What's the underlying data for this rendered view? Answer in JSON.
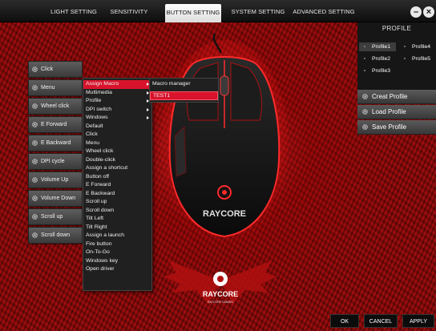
{
  "tabs": [
    {
      "label": "LIGHT SETTING",
      "active": false
    },
    {
      "label": "SENSITIVITY",
      "active": false
    },
    {
      "label": "BUTTON SETTING",
      "active": true
    },
    {
      "label": "SYSTEM SETTING",
      "active": false
    },
    {
      "label": "ADVANCED SETTING",
      "active": false
    }
  ],
  "window": {
    "minimize": "–",
    "close": "×"
  },
  "button_assignments": [
    "Click",
    "Menu",
    "Wheel click",
    "E Forward",
    "E Backward",
    "DPI cycle",
    "Volume Up",
    "Volume Down",
    "Scroll up",
    "Scroll down"
  ],
  "dropdown_menu": [
    {
      "label": "Assign Macro",
      "submenu": true,
      "selected": true
    },
    {
      "label": "Multimedia",
      "submenu": true
    },
    {
      "label": "Profile",
      "submenu": true
    },
    {
      "label": "DPI switch",
      "submenu": true
    },
    {
      "label": "Windows",
      "submenu": true
    },
    {
      "label": "Default"
    },
    {
      "label": "Click"
    },
    {
      "label": "Menu"
    },
    {
      "label": "Wheel click"
    },
    {
      "label": "Double-click"
    },
    {
      "label": "Assign a shortcut"
    },
    {
      "label": "Button off"
    },
    {
      "label": "E Forward"
    },
    {
      "label": "E Backward"
    },
    {
      "label": "Scroll up"
    },
    {
      "label": "Scroll down"
    },
    {
      "label": "Tilt Left"
    },
    {
      "label": "Tilt Right"
    },
    {
      "label": "Assign a launch"
    },
    {
      "label": "Fire button"
    },
    {
      "label": "On-To-Go"
    },
    {
      "label": "Windows key"
    },
    {
      "label": "Open driver"
    }
  ],
  "macro_submenu": [
    {
      "label": "Macro manager"
    },
    {
      "label": "TEST1",
      "selected": true
    }
  ],
  "mouse": {
    "brand": "RAYCORE"
  },
  "logo": {
    "brand": "RAYCORE",
    "tagline": "RAYCORE GAMING"
  },
  "profile": {
    "title": "PROFILE",
    "items": [
      {
        "label": "Profile1",
        "selected": true
      },
      {
        "label": "Profile4"
      },
      {
        "label": "Profile2"
      },
      {
        "label": "Profile5"
      },
      {
        "label": "Profile3"
      }
    ],
    "actions": [
      "Creat Profile",
      "Load Profile",
      "Save Profile"
    ]
  },
  "footer": {
    "ok": "OK",
    "cancel": "CANCEL",
    "apply": "APPLY"
  },
  "colors": {
    "accent": "#d8132b",
    "background": "#8a0a0a",
    "panel": "#161616"
  }
}
